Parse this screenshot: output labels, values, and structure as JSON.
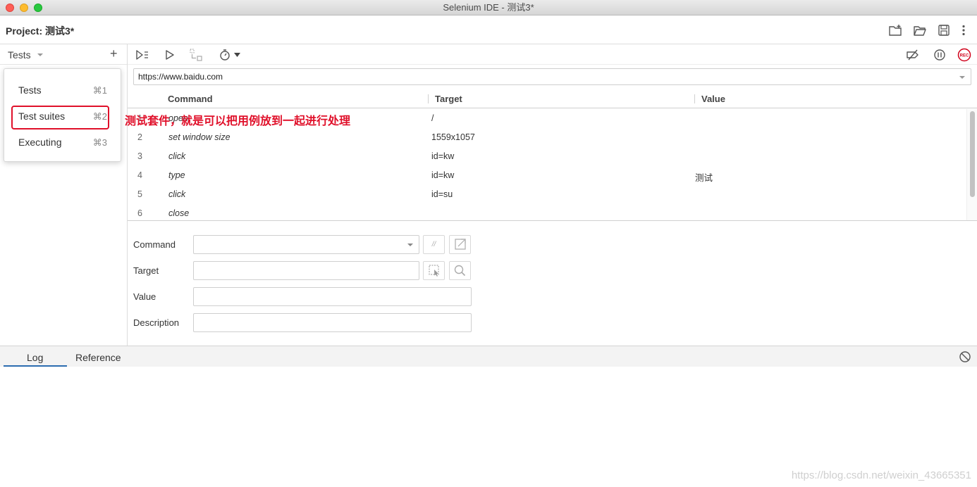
{
  "window": {
    "title": "Selenium IDE - 测试3*"
  },
  "project": {
    "label": "Project:",
    "name": "测试3*"
  },
  "sidebar": {
    "title": "Tests",
    "menu": [
      {
        "label": "Tests",
        "shortcut": "⌘1"
      },
      {
        "label": "Test suites",
        "shortcut": "⌘2"
      },
      {
        "label": "Executing",
        "shortcut": "⌘3"
      }
    ]
  },
  "annotation": "测试套件，就是可以把用例放到一起进行处理",
  "url": "https://www.baidu.com",
  "table": {
    "headers": {
      "command": "Command",
      "target": "Target",
      "value": "Value"
    },
    "rows": [
      {
        "num": "1",
        "command": "open",
        "target": "/",
        "value": ""
      },
      {
        "num": "2",
        "command": "set window size",
        "target": "1559x1057",
        "value": ""
      },
      {
        "num": "3",
        "command": "click",
        "target": "id=kw",
        "value": ""
      },
      {
        "num": "4",
        "command": "type",
        "target": "id=kw",
        "value": "测试"
      },
      {
        "num": "5",
        "command": "click",
        "target": "id=su",
        "value": ""
      },
      {
        "num": "6",
        "command": "close",
        "target": "",
        "value": ""
      }
    ]
  },
  "editor": {
    "command_label": "Command",
    "target_label": "Target",
    "value_label": "Value",
    "description_label": "Description",
    "comment_btn": "//"
  },
  "bottom": {
    "tabs": [
      "Log",
      "Reference"
    ]
  },
  "watermark": "https://blog.csdn.net/weixin_43665351",
  "colors": {
    "accent": "#2b6cb0",
    "annotation": "#e0102a",
    "rec": "#d0021b"
  }
}
